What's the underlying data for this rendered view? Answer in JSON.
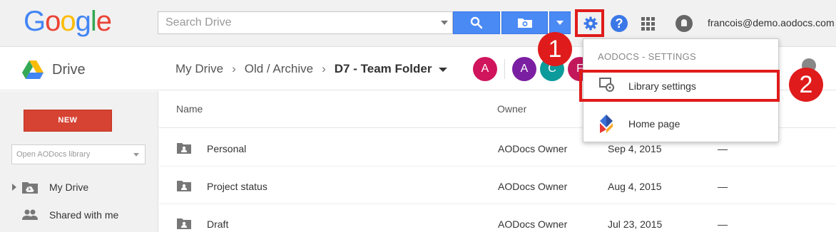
{
  "topbar": {
    "logo_letters": [
      {
        "char": "G",
        "color": "#4285f4"
      },
      {
        "char": "o",
        "color": "#ea4335"
      },
      {
        "char": "o",
        "color": "#fbbc05"
      },
      {
        "char": "g",
        "color": "#4285f4"
      },
      {
        "char": "l",
        "color": "#34a853"
      },
      {
        "char": "e",
        "color": "#ea4335"
      }
    ],
    "search_placeholder": "Search Drive",
    "search_button_icon": "search-icon",
    "folder_button_icon": "camera-folder-icon",
    "settings_icon": "gear-icon",
    "help_icon": "help-icon",
    "help_glyph": "?",
    "apps_icon": "apps-grid-icon",
    "notifications_icon": "notifications-icon",
    "user_email": "francois@demo.aodocs.com"
  },
  "subbar": {
    "app_label": "Drive",
    "breadcrumb": [
      "My Drive",
      "Old / Archive"
    ],
    "current_folder": "D7 - Team Folder",
    "sharers": [
      {
        "initial": "A",
        "color": "#d0155d"
      },
      {
        "initial": "A",
        "color": "#7b1fa2"
      },
      {
        "initial": "C",
        "color": "#0d9a9a"
      },
      {
        "initial": "F",
        "color": "#c2185b"
      }
    ]
  },
  "sidebar": {
    "new_label": "NEW",
    "library_select_placeholder": "Open AODocs library",
    "items": [
      {
        "label": "My Drive",
        "icon": "drive-folder-icon"
      },
      {
        "label": "Shared with me",
        "icon": "people-icon"
      }
    ]
  },
  "list": {
    "columns": {
      "name": "Name",
      "owner": "Owner"
    },
    "rows": [
      {
        "name": "Personal",
        "owner": "AODocs Owner",
        "date": "Sep 4, 2015",
        "size": "—"
      },
      {
        "name": "Project status",
        "owner": "AODocs Owner",
        "date": "Aug 4, 2015",
        "size": "—"
      },
      {
        "name": "Draft",
        "owner": "AODocs Owner",
        "date": "Jul 23, 2015",
        "size": "—"
      }
    ]
  },
  "settings_menu": {
    "heading": "AODOCS - SETTINGS",
    "items": [
      {
        "label": "Library settings",
        "icon": "library-settings-icon"
      },
      {
        "label": "Home page",
        "icon": "aodocs-logo-icon"
      }
    ]
  },
  "callouts": {
    "step1": "1",
    "step2": "2"
  },
  "colors": {
    "accent_blue": "#4a8af4",
    "new_button_red": "#d74333",
    "highlight_red": "#e01b1b"
  }
}
